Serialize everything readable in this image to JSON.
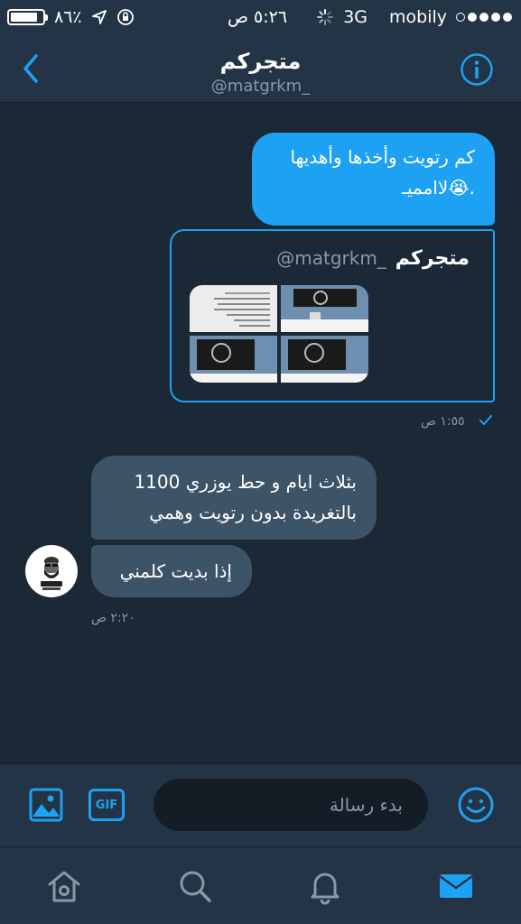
{
  "status_bar": {
    "battery": "٨٦٪",
    "time": "٥:٢٦ ص",
    "network": "3G",
    "carrier": "mobily"
  },
  "header": {
    "title": "متجركم",
    "handle": "@matgrkm_"
  },
  "messages": [
    {
      "direction": "outgoing",
      "text_line1": "كم رتويت وأخذها وأهديها",
      "text_line2": "لاامميـ😭."
    },
    {
      "direction": "outgoing-quote",
      "quote_name": "متجركم",
      "quote_handle": "@matgrkm_",
      "time": "١:٥٥ ص"
    },
    {
      "direction": "incoming",
      "text_line1": "1100 بثلاث ايام و حط يوزري",
      "text_line2": "بالتغريدة بدون رتويت وهمي"
    },
    {
      "direction": "incoming",
      "text": "إذا بديت كلمني",
      "time": "٢:٢٠ ص"
    }
  ],
  "composer": {
    "placeholder": "بدء رسالة",
    "gif_label": "GIF"
  },
  "colors": {
    "background": "#1b2836",
    "bar": "#243447",
    "accent": "#1da1f2",
    "incoming_bubble": "#3d5366",
    "muted": "#8899a6"
  },
  "icons": {
    "back": "chevron-left-icon",
    "info": "info-icon",
    "image": "image-icon",
    "emoji": "emoji-icon",
    "home": "home-icon",
    "search": "search-icon",
    "notifications": "bell-icon",
    "messages": "envelope-icon"
  }
}
